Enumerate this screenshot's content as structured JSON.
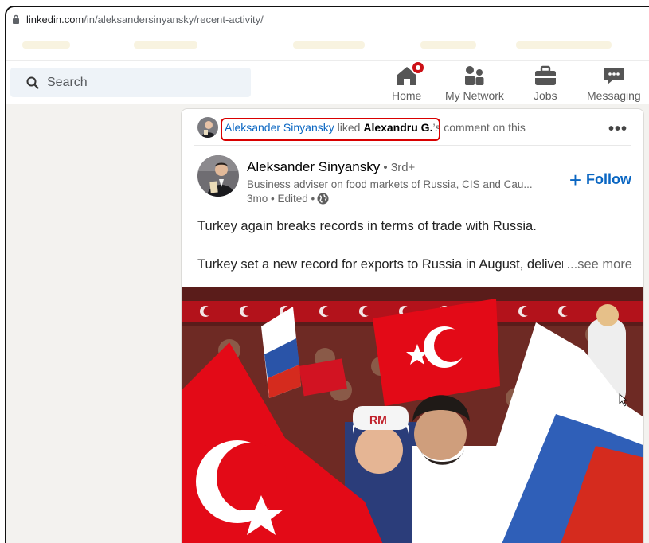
{
  "browser": {
    "url_host": "linkedin.com",
    "url_path": "/in/aleksandersinyansky/recent-activity/"
  },
  "navbar": {
    "search_placeholder": "Search",
    "items": [
      {
        "label": "Home",
        "icon": "home-icon"
      },
      {
        "label": "My Network",
        "icon": "people-icon"
      },
      {
        "label": "Jobs",
        "icon": "briefcase-icon"
      },
      {
        "label": "Messaging",
        "icon": "chat-icon"
      }
    ]
  },
  "post": {
    "activity": {
      "actor": "Aleksander Sinyansky",
      "verb": " liked ",
      "target": "Alexandru G.",
      "suffix": "’s comment on this"
    },
    "author": {
      "name": "Aleksander Sinyansky",
      "degree": " • 3rd+",
      "headline": "Business adviser on food markets of Russia, CIS and Cau...",
      "meta": "3mo • Edited • "
    },
    "follow_label": "Follow",
    "text_line1": "Turkey again breaks records in terms of trade with Russia.",
    "text_line2": "Turkey set a new record for exports to Russia in August, delivering",
    "see_more": "...see more",
    "image_cap_text": "RM"
  },
  "colors": {
    "linkedin_blue": "#0a66c2",
    "highlight_red": "#d90000",
    "notification_red": "#cc1016",
    "turkish_red": "#e30a17"
  }
}
